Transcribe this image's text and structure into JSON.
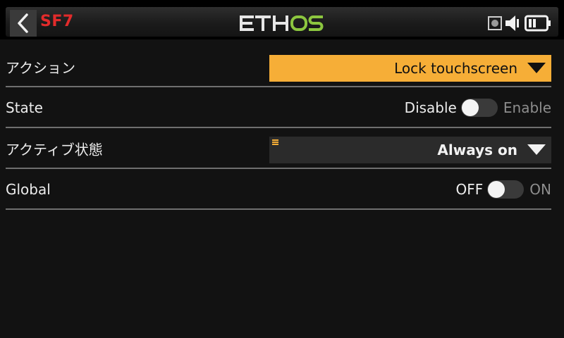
{
  "header": {
    "page_id": "SF7",
    "logo_text": "ETHOS",
    "icons": [
      "back-arrow-icon",
      "sd-card-icon",
      "speaker-icon",
      "battery-icon"
    ]
  },
  "rows": [
    {
      "label": "アクション",
      "control": "dropdown",
      "value": "Lock touchscreen",
      "highlight": true
    },
    {
      "label": "State",
      "control": "toggle",
      "off_label": "Disable",
      "on_label": "Enable",
      "state": "off"
    },
    {
      "label": "アクティブ状態",
      "control": "dropdown",
      "value": "Always on",
      "highlight": false
    },
    {
      "label": "Global",
      "control": "toggle",
      "off_label": "OFF",
      "on_label": "ON",
      "state": "off"
    }
  ],
  "colors": {
    "accent_orange": "#f6ae37",
    "page_id_red": "#e22b2b",
    "logo_green": "#8cc63f",
    "background": "#121212"
  }
}
